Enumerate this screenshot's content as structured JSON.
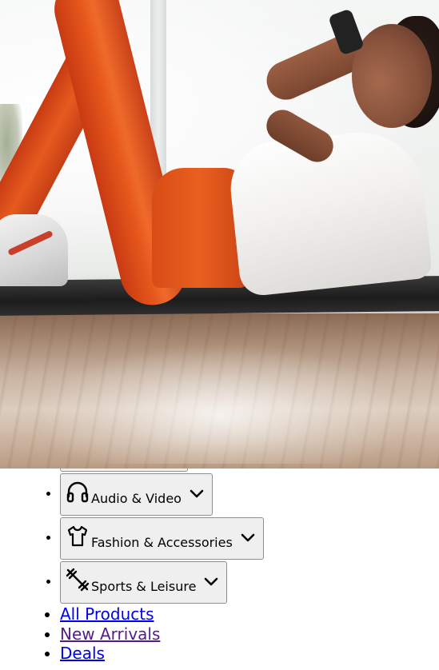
{
  "hero": {
    "image_subject": "woman-doing-crunches-on-mat"
  },
  "categories": [
    {
      "label": "Audio & Video",
      "icon": "headphones-icon"
    },
    {
      "label": "Fashion & Accessories",
      "icon": "tshirt-icon"
    },
    {
      "label": "Sports & Leisure",
      "icon": "dumbbell-icon"
    }
  ],
  "nav_links": [
    {
      "label": "All Products",
      "visited": false
    },
    {
      "label": "New Arrivals",
      "visited": true
    },
    {
      "label": "Deals",
      "visited": false
    }
  ],
  "colors": {
    "link": "#0000ee",
    "visited_link": "#551a8b",
    "button_bg": "#efefef",
    "button_border": "#8f8f8f"
  }
}
